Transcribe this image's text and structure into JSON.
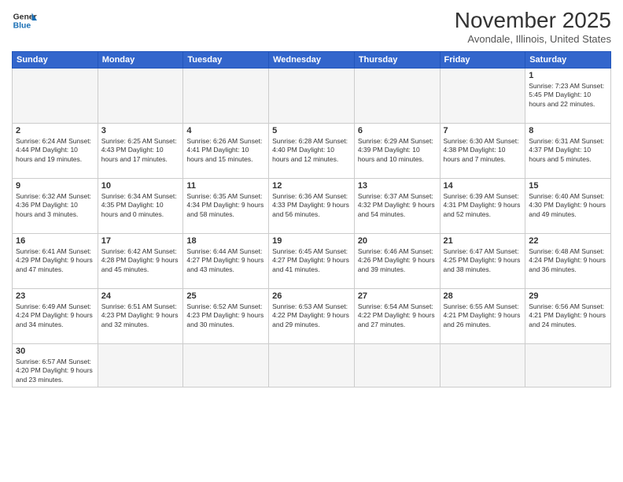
{
  "header": {
    "logo_general": "General",
    "logo_blue": "Blue",
    "title": "November 2025",
    "location": "Avondale, Illinois, United States"
  },
  "days_of_week": [
    "Sunday",
    "Monday",
    "Tuesday",
    "Wednesday",
    "Thursday",
    "Friday",
    "Saturday"
  ],
  "weeks": [
    [
      {
        "day": "",
        "info": "",
        "empty": true
      },
      {
        "day": "",
        "info": "",
        "empty": true
      },
      {
        "day": "",
        "info": "",
        "empty": true
      },
      {
        "day": "",
        "info": "",
        "empty": true
      },
      {
        "day": "",
        "info": "",
        "empty": true
      },
      {
        "day": "",
        "info": "",
        "empty": true
      },
      {
        "day": "1",
        "info": "Sunrise: 7:23 AM\nSunset: 5:45 PM\nDaylight: 10 hours\nand 22 minutes."
      }
    ],
    [
      {
        "day": "2",
        "info": "Sunrise: 6:24 AM\nSunset: 4:44 PM\nDaylight: 10 hours\nand 19 minutes."
      },
      {
        "day": "3",
        "info": "Sunrise: 6:25 AM\nSunset: 4:43 PM\nDaylight: 10 hours\nand 17 minutes."
      },
      {
        "day": "4",
        "info": "Sunrise: 6:26 AM\nSunset: 4:41 PM\nDaylight: 10 hours\nand 15 minutes."
      },
      {
        "day": "5",
        "info": "Sunrise: 6:28 AM\nSunset: 4:40 PM\nDaylight: 10 hours\nand 12 minutes."
      },
      {
        "day": "6",
        "info": "Sunrise: 6:29 AM\nSunset: 4:39 PM\nDaylight: 10 hours\nand 10 minutes."
      },
      {
        "day": "7",
        "info": "Sunrise: 6:30 AM\nSunset: 4:38 PM\nDaylight: 10 hours\nand 7 minutes."
      },
      {
        "day": "8",
        "info": "Sunrise: 6:31 AM\nSunset: 4:37 PM\nDaylight: 10 hours\nand 5 minutes."
      }
    ],
    [
      {
        "day": "9",
        "info": "Sunrise: 6:32 AM\nSunset: 4:36 PM\nDaylight: 10 hours\nand 3 minutes."
      },
      {
        "day": "10",
        "info": "Sunrise: 6:34 AM\nSunset: 4:35 PM\nDaylight: 10 hours\nand 0 minutes."
      },
      {
        "day": "11",
        "info": "Sunrise: 6:35 AM\nSunset: 4:34 PM\nDaylight: 9 hours\nand 58 minutes."
      },
      {
        "day": "12",
        "info": "Sunrise: 6:36 AM\nSunset: 4:33 PM\nDaylight: 9 hours\nand 56 minutes."
      },
      {
        "day": "13",
        "info": "Sunrise: 6:37 AM\nSunset: 4:32 PM\nDaylight: 9 hours\nand 54 minutes."
      },
      {
        "day": "14",
        "info": "Sunrise: 6:39 AM\nSunset: 4:31 PM\nDaylight: 9 hours\nand 52 minutes."
      },
      {
        "day": "15",
        "info": "Sunrise: 6:40 AM\nSunset: 4:30 PM\nDaylight: 9 hours\nand 49 minutes."
      }
    ],
    [
      {
        "day": "16",
        "info": "Sunrise: 6:41 AM\nSunset: 4:29 PM\nDaylight: 9 hours\nand 47 minutes."
      },
      {
        "day": "17",
        "info": "Sunrise: 6:42 AM\nSunset: 4:28 PM\nDaylight: 9 hours\nand 45 minutes."
      },
      {
        "day": "18",
        "info": "Sunrise: 6:44 AM\nSunset: 4:27 PM\nDaylight: 9 hours\nand 43 minutes."
      },
      {
        "day": "19",
        "info": "Sunrise: 6:45 AM\nSunset: 4:27 PM\nDaylight: 9 hours\nand 41 minutes."
      },
      {
        "day": "20",
        "info": "Sunrise: 6:46 AM\nSunset: 4:26 PM\nDaylight: 9 hours\nand 39 minutes."
      },
      {
        "day": "21",
        "info": "Sunrise: 6:47 AM\nSunset: 4:25 PM\nDaylight: 9 hours\nand 38 minutes."
      },
      {
        "day": "22",
        "info": "Sunrise: 6:48 AM\nSunset: 4:24 PM\nDaylight: 9 hours\nand 36 minutes."
      }
    ],
    [
      {
        "day": "23",
        "info": "Sunrise: 6:49 AM\nSunset: 4:24 PM\nDaylight: 9 hours\nand 34 minutes."
      },
      {
        "day": "24",
        "info": "Sunrise: 6:51 AM\nSunset: 4:23 PM\nDaylight: 9 hours\nand 32 minutes."
      },
      {
        "day": "25",
        "info": "Sunrise: 6:52 AM\nSunset: 4:23 PM\nDaylight: 9 hours\nand 30 minutes."
      },
      {
        "day": "26",
        "info": "Sunrise: 6:53 AM\nSunset: 4:22 PM\nDaylight: 9 hours\nand 29 minutes."
      },
      {
        "day": "27",
        "info": "Sunrise: 6:54 AM\nSunset: 4:22 PM\nDaylight: 9 hours\nand 27 minutes."
      },
      {
        "day": "28",
        "info": "Sunrise: 6:55 AM\nSunset: 4:21 PM\nDaylight: 9 hours\nand 26 minutes."
      },
      {
        "day": "29",
        "info": "Sunrise: 6:56 AM\nSunset: 4:21 PM\nDaylight: 9 hours\nand 24 minutes."
      }
    ],
    [
      {
        "day": "30",
        "info": "Sunrise: 6:57 AM\nSunset: 4:20 PM\nDaylight: 9 hours\nand 23 minutes.",
        "last": true
      },
      {
        "day": "",
        "info": "",
        "empty": true,
        "last": true
      },
      {
        "day": "",
        "info": "",
        "empty": true,
        "last": true
      },
      {
        "day": "",
        "info": "",
        "empty": true,
        "last": true
      },
      {
        "day": "",
        "info": "",
        "empty": true,
        "last": true
      },
      {
        "day": "",
        "info": "",
        "empty": true,
        "last": true
      },
      {
        "day": "",
        "info": "",
        "empty": true,
        "last": true
      }
    ]
  ]
}
